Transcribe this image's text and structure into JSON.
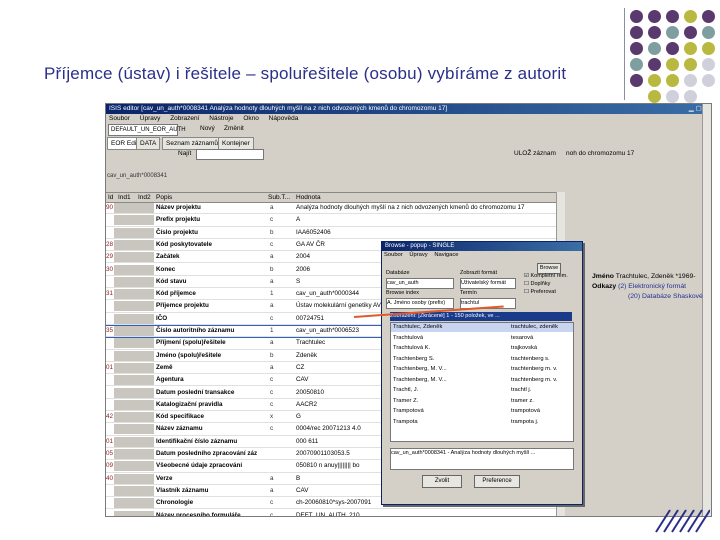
{
  "slide": {
    "title": "Příjemce (ústav) i řešitele – spoluřešitele (osobu) vybíráme z autorit"
  },
  "colors": {
    "title": "#2a2f8a",
    "dot_purple": "#5a3a6e",
    "dot_teal": "#7f9ea0",
    "dot_olive": "#b9b840",
    "dot_light": "#cfd0dc"
  },
  "app": {
    "window_title": "ISIS editor  [cav_un_auth*0008341 Analýza hodnoty dlouhých myšlí na z nich odvozených kmenů do chromozomu 17]",
    "menu": [
      "Soubor",
      "Úpravy",
      "Zobrazení",
      "Nástroje",
      "Okno",
      "Nápověda"
    ],
    "toolbar_select": "DEFAULT_UN_EOR_AUTH",
    "toolbar_new": "Nový",
    "toolbar_open": "Změnit",
    "tabs": [
      "EOR Editor",
      "DATA",
      "Seznam záznamů",
      "Kontejner"
    ],
    "find_label": "Najít",
    "find_button": "ULOŽ záznam",
    "record_id": "cav_un_auth*0008341",
    "grid_headers": [
      "Id",
      "Ind1",
      "Ind2",
      "Popis",
      "Sub.T...",
      "Hodnota"
    ],
    "rows": [
      {
        "n": "90",
        "label": "Název projektu",
        "type": "a",
        "value": "Analýza hodnoty dlouhých myšlí na z nich odvozených kmenů do chromozomu 17"
      },
      {
        "n": "",
        "label": "Prefix projektu",
        "type": "c",
        "value": "A"
      },
      {
        "n": "",
        "label": "Číslo projektu",
        "type": "b",
        "value": "IAA6052406"
      },
      {
        "n": "28",
        "label": "Kód poskytovatele",
        "type": "c",
        "value": "GA AV ČR"
      },
      {
        "n": "29",
        "label": "Začátek",
        "type": "a",
        "value": "2004"
      },
      {
        "n": "30",
        "label": "Konec",
        "type": "b",
        "value": "2006"
      },
      {
        "n": "",
        "label": "Kód stavu",
        "type": "a",
        "value": "S"
      },
      {
        "n": "31",
        "label": "Kód příjemce",
        "type": "1",
        "value": "cav_un_auth*0000344"
      },
      {
        "n": "",
        "label": "Příjemce projektu",
        "type": "a",
        "value": "Ústav molekulární genetiky AV ČR"
      },
      {
        "n": "",
        "label": "IČO",
        "type": "c",
        "value": "00724751"
      },
      {
        "n": "35",
        "label": "Číslo autoritního záznamu",
        "type": "1",
        "value": "cav_un_auth*0006523"
      },
      {
        "n": "",
        "label": "Příjmení (spolu)řešitele",
        "type": "a",
        "value": "Trachtulec"
      },
      {
        "n": "",
        "label": "Jméno (spolu)řešitele",
        "type": "b",
        "value": "Zdeněk"
      },
      {
        "n": "01",
        "label": "Země",
        "type": "a",
        "value": "CZ"
      },
      {
        "n": "",
        "label": "Agentura",
        "type": "c",
        "value": "CAV"
      },
      {
        "n": "",
        "label": "Datum poslední transakce",
        "type": "c",
        "value": "20050810"
      },
      {
        "n": "",
        "label": "Katalogizační pravidla",
        "type": "c",
        "value": "AACR2"
      },
      {
        "n": "42",
        "label": "Kód specifikace",
        "type": "x",
        "value": "G"
      },
      {
        "n": "",
        "label": "Název záznamu",
        "type": "c",
        "value": "0004/rec 20071213 4.0"
      },
      {
        "n": "01",
        "label": "Identifikační číslo záznamu",
        "type": "",
        "value": "000 611"
      },
      {
        "n": "05",
        "label": "Datum posledního zpracování záz",
        "type": "",
        "value": "20070901103053.5"
      },
      {
        "n": "09",
        "label": "Všeobecné údaje zpracování",
        "type": "",
        "value": "050810 n anuy|||||||| bo"
      },
      {
        "n": "40",
        "label": "Verze",
        "type": "a",
        "value": "B"
      },
      {
        "n": "",
        "label": "Vlastník záznamu",
        "type": "a",
        "value": "CAV"
      },
      {
        "n": "",
        "label": "Chronologie",
        "type": "c",
        "value": "ch-20060810*sys-2007091"
      },
      {
        "n": "",
        "label": "Název procesního formuláře",
        "type": "c",
        "value": "DEFT_UN_AUTH_210"
      }
    ],
    "right_text": "noh do chromozomu 17"
  },
  "popup": {
    "title": "Browse - popup - SINGLE",
    "menu": [
      "Soubor",
      "Úpravy",
      "Navigace"
    ],
    "btn_browse": "Browse",
    "label_database": "Databáze",
    "label_format": "Zobrazit formát",
    "label_index": "Browse index",
    "label_term": "Termín",
    "database_value": "cav_un_auth",
    "format_value": "Uživatelský formát",
    "index_value": "A. Jméno osoby (prefix)",
    "term_value": "trachtul",
    "checks": [
      "Kompletní rem.",
      "Doplňky",
      "Preferovat"
    ],
    "list_header": "Zobrazení: [Zkrácené] 1 - 150 položek, ve ...",
    "list_header2": "...",
    "items": [
      {
        "name": "Trachtulec, Zdeněk",
        "short": "trachtulec, zdeněk"
      },
      {
        "name": "Trachtulová",
        "short": "tesarová"
      },
      {
        "name": "Trachtulová K.",
        "short": "trajkovská"
      },
      {
        "name": "Trachtenberg S.",
        "short": "trachtenberg s."
      },
      {
        "name": "Trachtenberg, M. V...",
        "short": "trachtenberg m. v."
      },
      {
        "name": "Trachtenberg, M. V...",
        "short": "trachtenberg m. v."
      },
      {
        "name": "Trachtl, J.",
        "short": "trachtl j."
      },
      {
        "name": "Tramer Z.",
        "short": "tramer z."
      },
      {
        "name": "Trampotová",
        "short": "trampotová"
      },
      {
        "name": "Trampota",
        "short": "trampota j."
      }
    ],
    "status": "cav_un_auth*0008341 - Analýza hodnoty dlouhých myšlí ...",
    "btn_ok": "Zvolit",
    "btn_prefs": "Preference"
  },
  "links": {
    "label_name": "Jméno",
    "label_refs": "Odkazy",
    "name_value": "Trachtulec, Zdeněk *1969-",
    "ref1": "(2) Elektronický formát",
    "ref2": "(20) Databáze Shaskové"
  }
}
